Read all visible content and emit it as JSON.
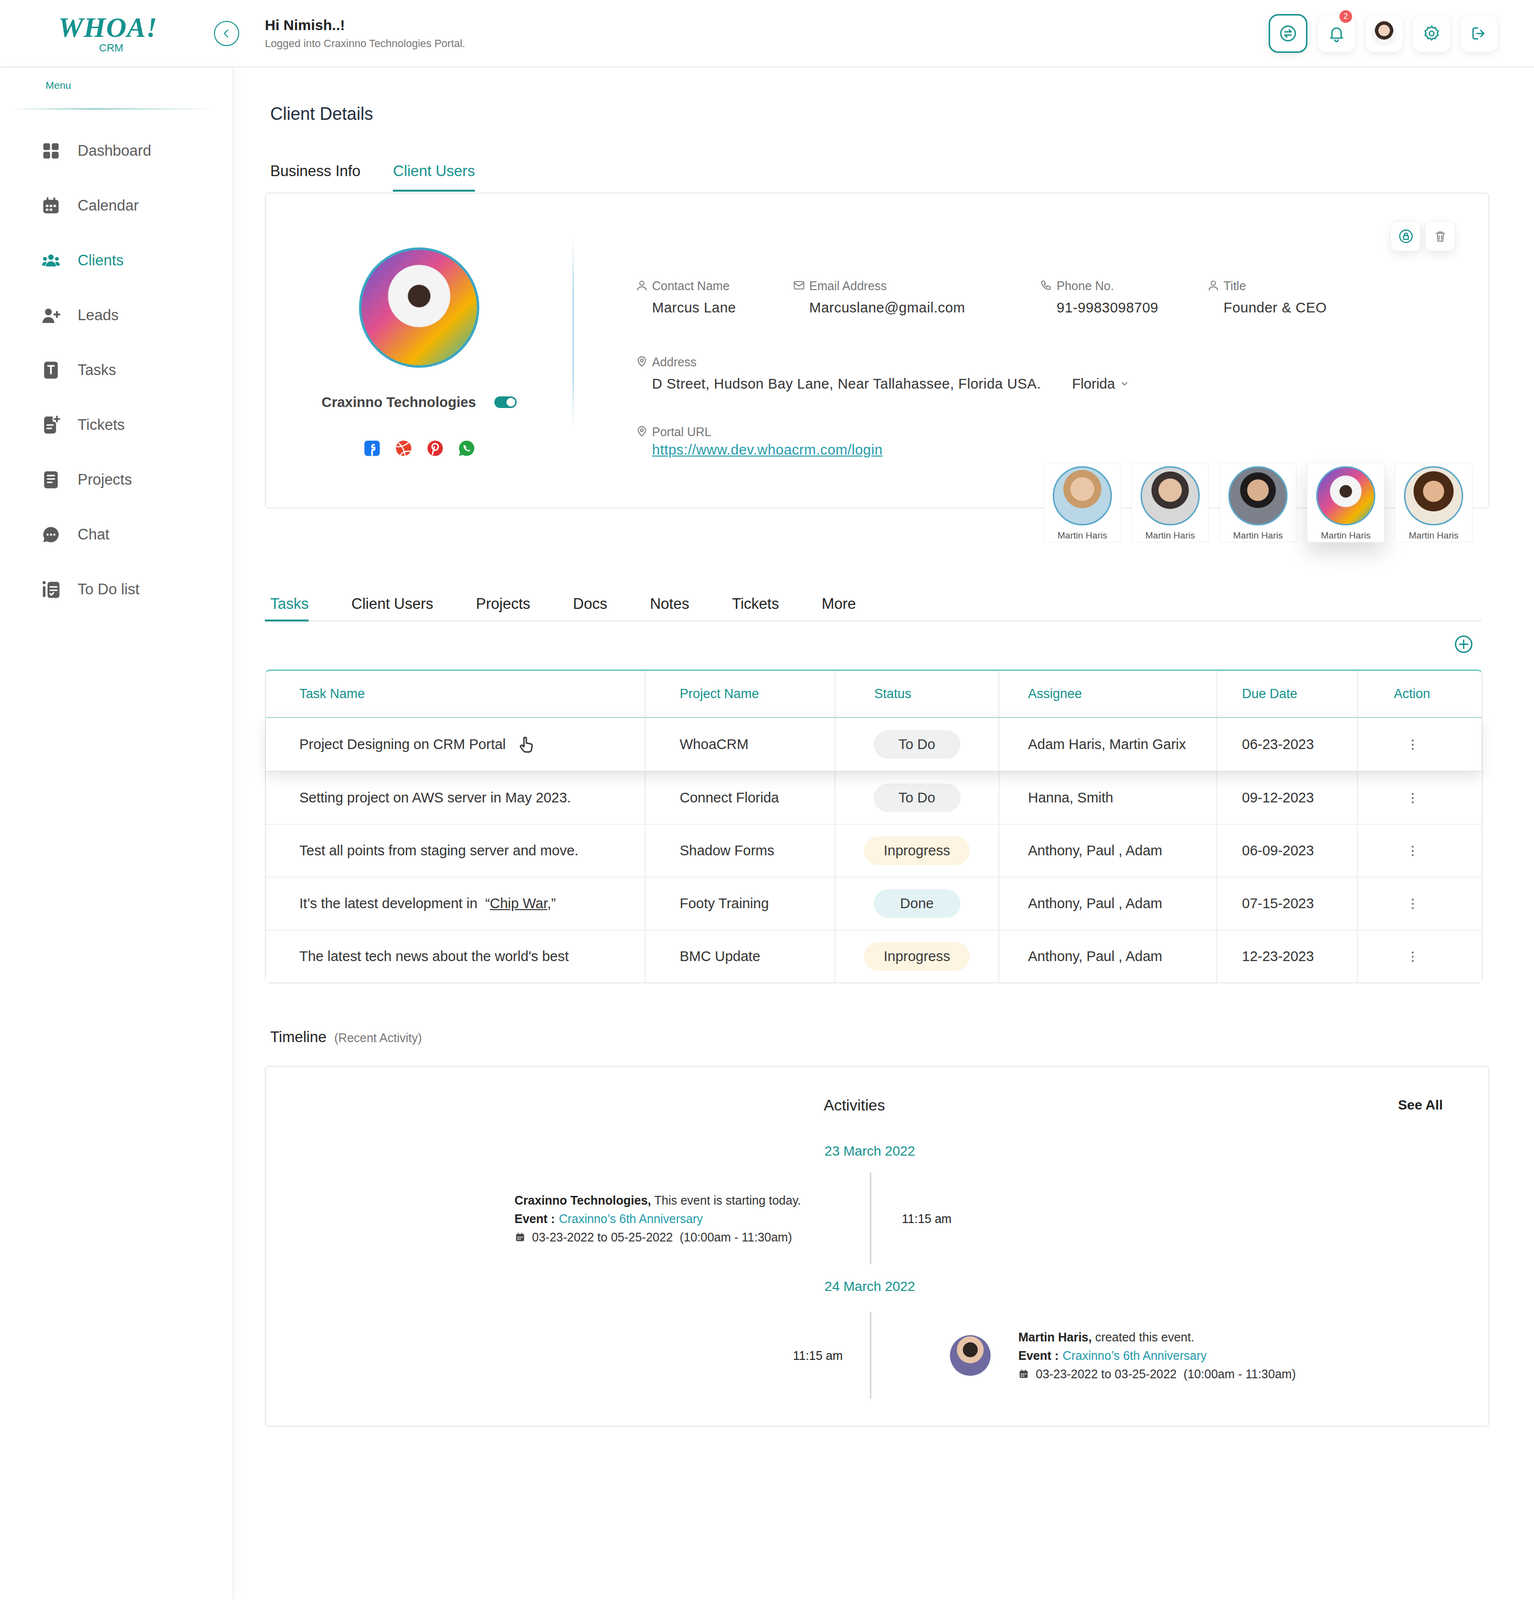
{
  "header": {
    "logo": "WHOA!",
    "logo_sub": "CRM",
    "greeting": "Hi Nimish..!",
    "subtitle": "Logged into Craxinno Technologies Portal.",
    "notification_count": "2"
  },
  "sidebar": {
    "menu_label": "Menu",
    "items": [
      {
        "label": "Dashboard",
        "selected": false
      },
      {
        "label": "Calendar",
        "selected": false
      },
      {
        "label": "Clients",
        "selected": true
      },
      {
        "label": "Leads",
        "selected": false
      },
      {
        "label": "Tasks",
        "selected": false
      },
      {
        "label": "Tickets",
        "selected": false
      },
      {
        "label": "Projects",
        "selected": false
      },
      {
        "label": "Chat",
        "selected": false
      },
      {
        "label": "To Do list",
        "selected": false
      }
    ]
  },
  "page_title": "Client Details",
  "detail_tabs": [
    {
      "label": "Business Info",
      "selected": false
    },
    {
      "label": "Client Users",
      "selected": true
    }
  ],
  "profile": {
    "company": "Craxinno Technologies",
    "active": true,
    "fields": [
      {
        "label": "Contact Name",
        "value": "Marcus Lane"
      },
      {
        "label": "Email Address",
        "value": "Marcuslane@gmail.com"
      },
      {
        "label": "Phone No.",
        "value": "91-9983098709"
      },
      {
        "label": "Title",
        "value": "Founder & CEO"
      }
    ],
    "address": {
      "label": "Address",
      "value": "D Street, Hudson Bay Lane, Near Tallahassee, Florida USA.",
      "state": "Florida"
    },
    "portal": {
      "label": "Portal URL",
      "value": "https://www.dev.whoacrm.com/login"
    }
  },
  "client_users": [
    {
      "name": "Martin Haris",
      "selected": false
    },
    {
      "name": "Martin Haris",
      "selected": false
    },
    {
      "name": "Martin Haris",
      "selected": false
    },
    {
      "name": "Martin Haris",
      "selected": true
    },
    {
      "name": "Martin Haris",
      "selected": false
    }
  ],
  "section_tabs": [
    {
      "label": "Tasks",
      "selected": true
    },
    {
      "label": "Client Users",
      "selected": false
    },
    {
      "label": "Projects",
      "selected": false
    },
    {
      "label": "Docs",
      "selected": false
    },
    {
      "label": "Notes",
      "selected": false
    },
    {
      "label": "Tickets",
      "selected": false
    },
    {
      "label": "More",
      "selected": false
    }
  ],
  "table": {
    "columns": [
      "Task Name",
      "Project Name",
      "Status",
      "Assignee",
      "Due Date",
      "Action"
    ],
    "rows": [
      {
        "task": [
          {
            "text": "Project Designing on CRM Portal",
            "underlined": false
          }
        ],
        "project": "WhoaCRM",
        "status": {
          "label": "To Do",
          "color": "#eef0f1"
        },
        "assignee": "Adam Haris, Martin Garix",
        "due": "06-23-2023",
        "hovered": true
      },
      {
        "task": [
          {
            "text": "Setting project on AWS server in May 2023.",
            "underlined": false
          }
        ],
        "project": "Connect Florida",
        "status": {
          "label": "To Do",
          "color": "#eef0f1"
        },
        "assignee": "Hanna, Smith",
        "due": "09-12-2023",
        "hovered": false
      },
      {
        "task": [
          {
            "text": "Test all points from staging server and move.",
            "underlined": false
          }
        ],
        "project": "Shadow Forms",
        "status": {
          "label": "Inprogress",
          "color": "#fdf5e1"
        },
        "assignee": "Anthony, Paul , Adam",
        "due": "06-09-2023",
        "hovered": false
      },
      {
        "task": [
          {
            "text": "It’s the latest development in  “",
            "underlined": false
          },
          {
            "text": "Chip War,",
            "underlined": true
          },
          {
            "text": "”",
            "underlined": false
          }
        ],
        "project": "Footy Training",
        "status": {
          "label": "Done",
          "color": "#e3f3f5"
        },
        "assignee": "Anthony, Paul , Adam",
        "due": "07-15-2023",
        "hovered": false
      },
      {
        "task": [
          {
            "text": "The latest tech news about the world's best",
            "underlined": false
          }
        ],
        "project": "BMC Update",
        "status": {
          "label": "Inprogress",
          "color": "#fdf5e1"
        },
        "assignee": "Anthony, Paul , Adam",
        "due": "12-23-2023",
        "hovered": false
      }
    ]
  },
  "timeline": {
    "title": "Timeline",
    "subtitle": "(Recent Activity)",
    "heading": "Activities",
    "see_all": "See All",
    "groups": [
      {
        "date": "23 March 2022",
        "kind": "left",
        "who": "Craxinno Technologies,",
        "action": " This event is starting today.",
        "event_label": "Event :",
        "event_name": "Craxinno’s 6th Anniversary",
        "range": "03-23-2022 to 05-25-2022  (10:00am - 11:30am)",
        "time": "11:15 am"
      },
      {
        "date": "24 March 2022",
        "kind": "right",
        "who": "Martin Haris,",
        "action": " created this event.",
        "event_label": "Event :",
        "event_name": "Craxinno’s 6th Anniversary",
        "range": "03-23-2022 to 03-25-2022  (10:00am - 11:30am)",
        "time": "11:15 am"
      }
    ]
  }
}
